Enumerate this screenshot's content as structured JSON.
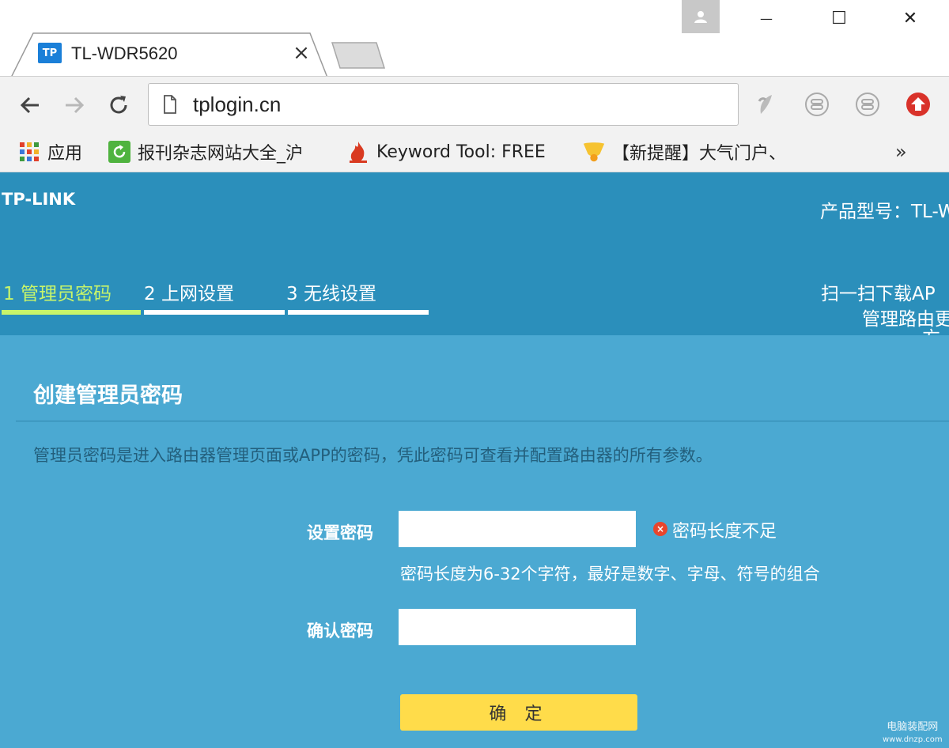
{
  "browser": {
    "tab": {
      "favicon_text": "TP",
      "title": "TL-WDR5620",
      "close_glyph": "×"
    },
    "window": {
      "minimize_glyph": "—",
      "maximize_glyph": "☐",
      "close_glyph": "✕"
    },
    "address": {
      "url": "tplogin.cn"
    },
    "bookmarks": [
      {
        "label": "应用",
        "icon": "apps-grid-icon"
      },
      {
        "label": "报刊杂志网站大全_沪",
        "icon": "refresh-green-icon"
      },
      {
        "label": "Keyword Tool: FREE",
        "icon": "flame-icon"
      },
      {
        "label": "【新提醒】大气门户、",
        "icon": "bell-icon"
      }
    ],
    "bookmarks_more": "»"
  },
  "router": {
    "brand": "TP-LINK",
    "model_label": "产品型号：TL-W",
    "steps": [
      {
        "label": "1 管理员密码",
        "active": true
      },
      {
        "label": "2 上网设置",
        "active": false
      },
      {
        "label": "3 无线设置",
        "active": false
      }
    ],
    "qr_line1": "扫一扫下载AP",
    "qr_line2": "管理路由更",
    "qr_line3": "方",
    "section_title": "创建管理员密码",
    "section_desc": "管理员密码是进入路由器管理页面或APP的密码，凭此密码可查看并配置路由器的所有参数。",
    "set_password_label": "设置密码",
    "set_password_value": "",
    "error_text": "密码长度不足",
    "hint_text": "密码长度为6-32个字符，最好是数字、字母、符号的组合",
    "confirm_password_label": "确认密码",
    "confirm_password_value": "",
    "confirm_button": "确 定"
  },
  "watermark": {
    "line1": "电脑装配网",
    "line2": "www.dnzp.com"
  },
  "colors": {
    "header_band": "#2b8fbb",
    "page_bg": "#4ba9d2",
    "active_step": "#c8f56a",
    "confirm_button": "#ffdc4a",
    "error": "#e8452c"
  }
}
